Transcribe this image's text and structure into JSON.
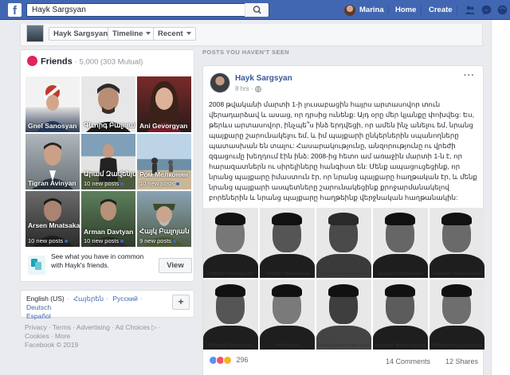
{
  "topbar": {
    "logo": "f",
    "search_value": "Hayk Sargsyan",
    "search_placeholder": "Search",
    "user_name": "Marina",
    "home": "Home",
    "create": "Create",
    "icons": [
      "search-icon",
      "friend-requests-icon",
      "messenger-icon",
      "notifications-icon"
    ],
    "bg_color": "#4267b2"
  },
  "subbar": {
    "name_button": "Hayk Sargsyan",
    "timeline": "Timeline",
    "recent": "Recent"
  },
  "friends": {
    "title": "Friends",
    "count": "· 5,000 (303 Mutual)",
    "tiles": [
      {
        "name": "Gnel Sanosyan",
        "posts": ""
      },
      {
        "name": "Գևորգ Բալոյան",
        "posts": ""
      },
      {
        "name": "Ani Gevorgyan",
        "posts": ""
      },
      {
        "name": "Tigran Avinyan",
        "posts": ""
      },
      {
        "name": "Արամ Զավենյան",
        "posts": "10 new posts"
      },
      {
        "name": "Ром Мелконян",
        "posts": "10 new posts"
      },
      {
        "name": "Arsen Mnatsakanyan",
        "posts": "10 new posts"
      },
      {
        "name": "Arman Davtyan",
        "posts": "10 new posts"
      },
      {
        "name": "Հայկ Բալոյան",
        "posts": "9 new posts"
      }
    ],
    "common_text": "See what you have in common with Hayk's friends.",
    "view_button": "View"
  },
  "languages": {
    "links": [
      "English (US)",
      "Հայերեն",
      "Русский",
      "Deutsch",
      "Español"
    ],
    "plus": "+"
  },
  "footer": {
    "links": [
      "Privacy",
      "Terms",
      "Advertising",
      "Ad Choices",
      "Cookies",
      "More"
    ],
    "copyright": "Facebook © 2019"
  },
  "section_label": "POSTS YOU HAVEN'T SEEN",
  "post": {
    "author": "Hayk Sargsyan",
    "time": "8 hrs · ",
    "more": "···",
    "text": "2008 թվականի մարտի 1-ի լուսաբացին հայրս արտասովոր տուն վերադարձավ և ասաց, որ դրսից ունենք: Այդ օրը մեր կյանքը փոխվեց: Ես, թերևս արտասովոր, ինչպե՞ս ինձ երդվեցի, որ ամեն ինչ անելու եմ, նրանց պայքարը շարունակելու եմ, և իմ պայքարի ընկերներին սպանողները պատասխան են տալու: Հասարակությունը, անզորությունը ու վրեժի զգացումը խեղդում էին ինձ: 2008-ից հետո ամ առաջին մարտի 1-ն է, որ հարազատներն ու սիրելիները հանգիստ են: Մենք ապացուցեցինք, որ նրանց պայքարը իմաստուն էր, որ նրանց պայքարը հաղթական էր, և մենք նրանց պայքարի ասպետները շարունակեցինք քրոջարմանակելով բորեներին և նրանց պայքարը հաղթեինք վերջնական հաղթանակին:",
    "photo_captions": [
      "Գրիգոր Գևորգյանի",
      "Դավիթ Պետրոսյան",
      "Արմեն Ֆարմանյան",
      "Զաքար Հովհաննիս",
      "Համլետ Թադևոսյան",
      "Տիգրան Աբգարյան",
      "Գոռ Քոչար",
      "Սամվել Հարությունյան",
      "Համլետ Թադևոսյանը",
      "Տիգրան Խաչատրյան"
    ],
    "reactions_count": "296",
    "comments": "14 Comments",
    "shares": "12 Shares",
    "reaction_colors": [
      "#5890ff",
      "#f25268",
      "#f7b125"
    ]
  }
}
